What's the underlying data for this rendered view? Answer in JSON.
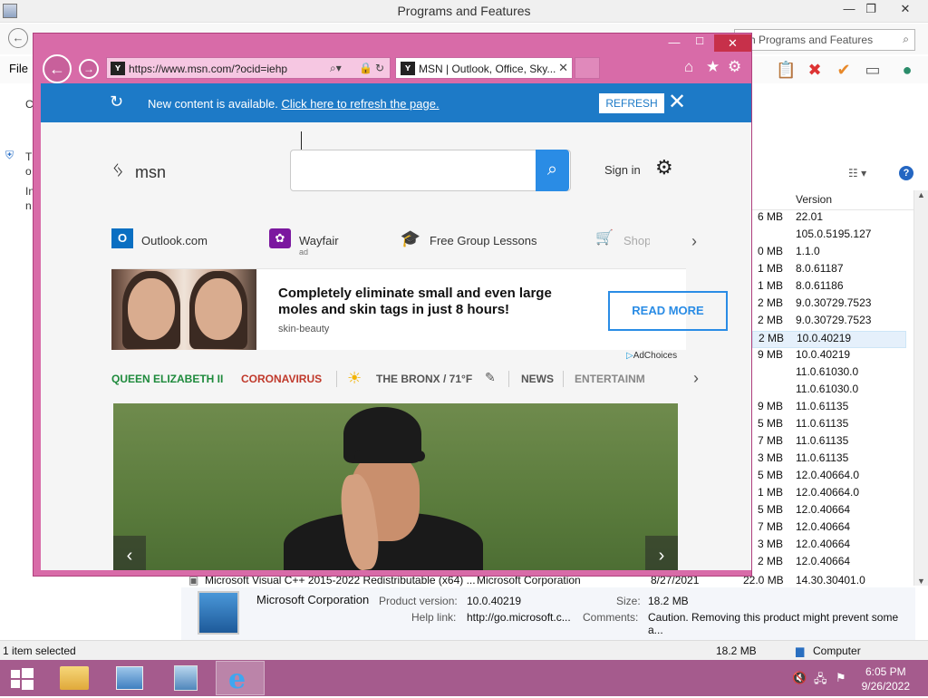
{
  "pf": {
    "title": "Programs and Features",
    "search_placeholder": "rch Programs and Features",
    "menu_file": "File",
    "left_labels": [
      "C",
      "T",
      "o",
      "In",
      "n"
    ],
    "column_version": "Version",
    "rows": [
      {
        "size": "6 MB",
        "version": "22.01"
      },
      {
        "size": "",
        "version": "105.0.5195.127"
      },
      {
        "size": "0 MB",
        "version": "1.1.0"
      },
      {
        "size": "1 MB",
        "version": "8.0.61187"
      },
      {
        "size": "1 MB",
        "version": "8.0.61186"
      },
      {
        "size": "2 MB",
        "version": "9.0.30729.7523"
      },
      {
        "size": "2 MB",
        "version": "9.0.30729.7523"
      },
      {
        "size": "2 MB",
        "version": "10.0.40219"
      },
      {
        "size": "9 MB",
        "version": "10.0.40219"
      },
      {
        "size": "",
        "version": "11.0.61030.0"
      },
      {
        "size": "",
        "version": "11.0.61030.0"
      },
      {
        "size": "9 MB",
        "version": "11.0.61135"
      },
      {
        "size": "5 MB",
        "version": "11.0.61135"
      },
      {
        "size": "7 MB",
        "version": "11.0.61135"
      },
      {
        "size": "3 MB",
        "version": "11.0.61135"
      },
      {
        "size": "5 MB",
        "version": "12.0.40664.0"
      },
      {
        "size": "1 MB",
        "version": "12.0.40664.0"
      },
      {
        "size": "5 MB",
        "version": "12.0.40664"
      },
      {
        "size": "7 MB",
        "version": "12.0.40664"
      },
      {
        "size": "3 MB",
        "version": "12.0.40664"
      },
      {
        "size": "2 MB",
        "version": "12.0.40664"
      }
    ],
    "bottom_row": {
      "name": "Microsoft Visual C++ 2015-2022 Redistributable (x64) ...",
      "publisher": "Microsoft Corporation",
      "date": "8/27/2021",
      "size": "22.0 MB",
      "version": "14.30.30401.0"
    },
    "details": {
      "publisher": "Microsoft Corporation",
      "product_version_label": "Product version:",
      "product_version": "10.0.40219",
      "size_label": "Size:",
      "size": "18.2 MB",
      "help_label": "Help link:",
      "help": "http://go.microsoft.c...",
      "comments_label": "Comments:",
      "comments": "Caution. Removing this product might prevent some a..."
    },
    "status": {
      "selected": "1 item selected",
      "size": "18.2 MB",
      "computer": "Computer"
    }
  },
  "ie": {
    "url": "https://www.msn.com/?ocid=iehp",
    "tab_title": "MSN | Outlook, Office, Sky...",
    "notify": {
      "text": "New content is available.",
      "link": "Click here to refresh the page.",
      "button": "REFRESH"
    }
  },
  "msn": {
    "logo": "msn",
    "signin": "Sign in",
    "quick": [
      {
        "label": "Outlook.com",
        "icon": "outlook-icon"
      },
      {
        "label": "Wayfair",
        "icon": "wayfair-icon",
        "ad": "ad"
      },
      {
        "label": "Free Group Lessons",
        "icon": "graduation-cap-icon"
      },
      {
        "label": "Shop",
        "icon": "cart-icon"
      }
    ],
    "ad": {
      "headline": "Completely eliminate small and even large moles and skin tags in just 8 hours!",
      "source": "skin-beauty",
      "button": "READ MORE",
      "adchoices": "AdChoices"
    },
    "topics": [
      {
        "label": "QUEEN ELIZABETH II",
        "color": "#1e8a3c"
      },
      {
        "label": "CORONAVIRUS",
        "color": "#c0392b"
      },
      {
        "label": "THE BRONX / 71°F",
        "color": "#555555"
      },
      {
        "label": "NEWS",
        "color": "#555555"
      },
      {
        "label": "ENTERTAINM",
        "color": "#888888"
      }
    ]
  },
  "taskbar": {
    "time": "6:05 PM",
    "date": "9/26/2022"
  }
}
